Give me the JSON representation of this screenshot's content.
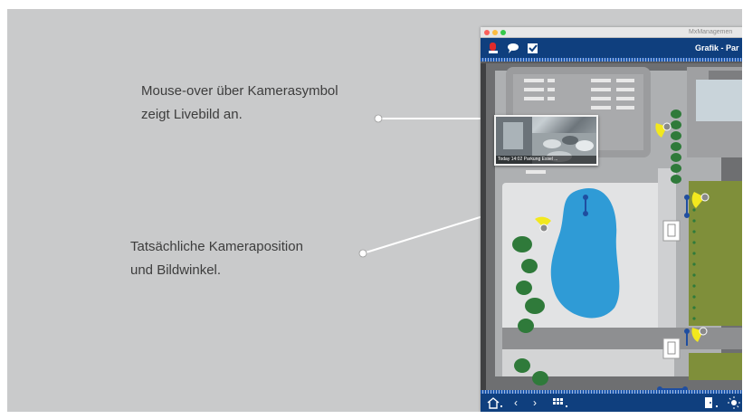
{
  "annotations": {
    "livebild_line1": "Mouse-over über Kamerasymbol",
    "livebild_line2": "zeigt Livebild an.",
    "position_line1": "Tatsächliche Kameraposition",
    "position_line2": "und Bildwinkel."
  },
  "window": {
    "title": "MxManagemen",
    "view_title": "Grafik - Par"
  },
  "live_popup": {
    "caption": "Today 14:02  Parkung Essel  ..."
  },
  "toolbar": {
    "icons": [
      "alarm-icon",
      "message-icon",
      "checkbox-icon"
    ]
  },
  "bottom_bar": {
    "icons": [
      "home-icon",
      "back-icon",
      "forward-icon",
      "grid-icon",
      "door-icon",
      "light-icon"
    ]
  },
  "colors": {
    "toolbar": "#0f3f7e",
    "camera": "#f2e81e",
    "tree": "#2f7a3a",
    "pond": "#2f9bd6",
    "lawn": "#7f8f3a"
  }
}
